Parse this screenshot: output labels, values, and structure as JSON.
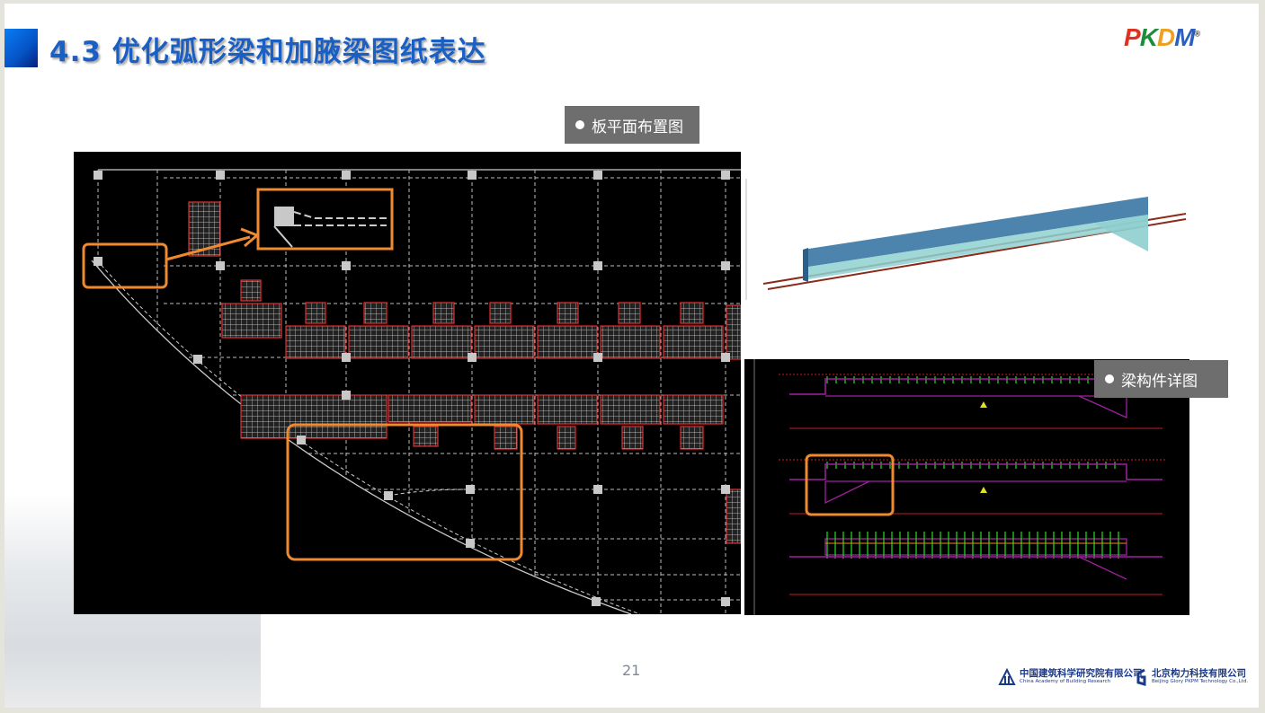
{
  "slide": {
    "title": "4.3 优化弧形梁和加腋梁图纸表达",
    "page_number": "21"
  },
  "logo": {
    "p": "P",
    "k": "K",
    "d": "D",
    "m": "M",
    "reg": "®"
  },
  "labels": {
    "slab_plan": "板平面布置图",
    "beam_detail": "梁构件详图"
  },
  "footer": {
    "org1_name": "中国建筑科学研究院有限公司",
    "org1_en": "China Academy of Building Research",
    "org2_name": "北京构力科技有限公司",
    "org2_en": "Beijing Glory PKPM Technology Co.,Ltd."
  },
  "colors": {
    "title_blue": "#1a5fc4",
    "highlight_orange": "#f08a30",
    "label_gray": "#6e6e6e",
    "cad_background": "#000000"
  }
}
